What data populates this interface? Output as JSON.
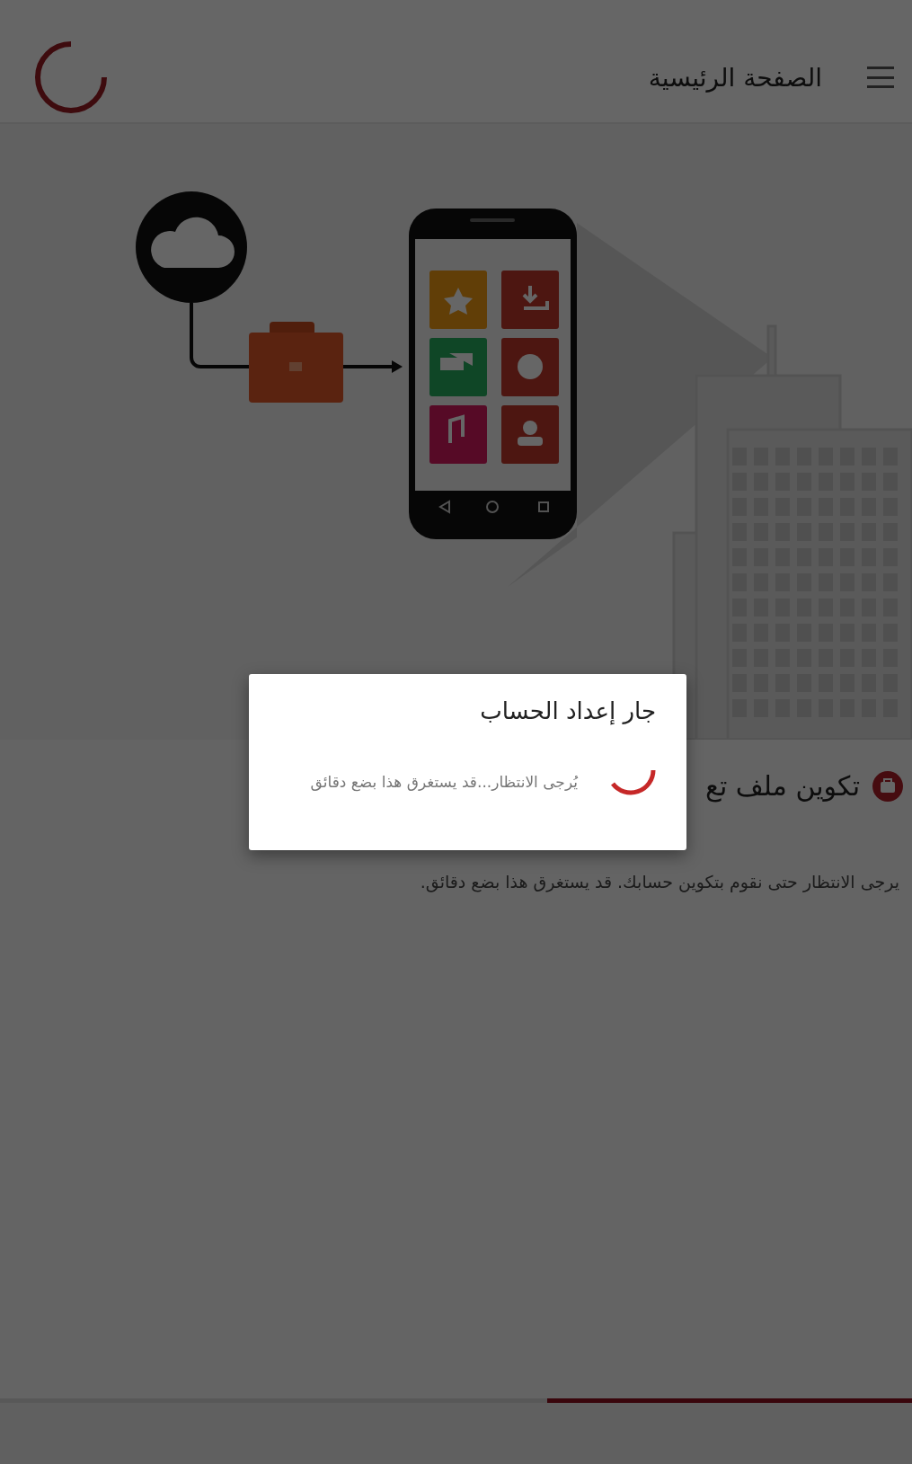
{
  "header": {
    "title": "الصفحة الرئيسية"
  },
  "section": {
    "title": "تكوين ملف تع",
    "text": "يرجى الانتظار حتى نقوم بتكوين حسابك. قد يستغرق هذا بضع دقائق."
  },
  "progress": {
    "level": 0.4
  },
  "dialog": {
    "title": "جار إعداد الحساب",
    "message": "يُرجى الانتظار...قد يستغرق هذا بضع دقائق"
  }
}
